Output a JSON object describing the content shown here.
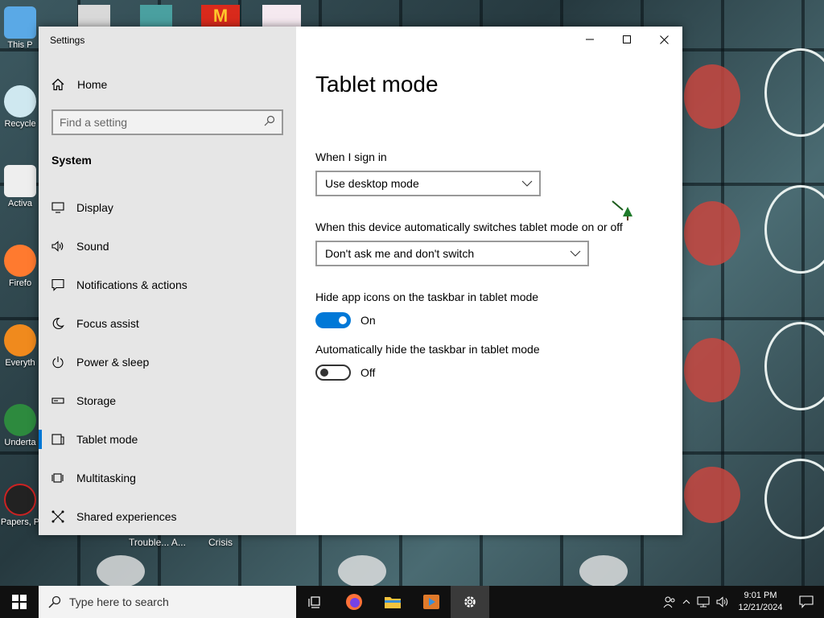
{
  "window": {
    "title": "Settings"
  },
  "sidebar": {
    "home_label": "Home",
    "search_placeholder": "Find a setting",
    "section_title": "System",
    "items": [
      {
        "label": "Display",
        "icon": "monitor-icon"
      },
      {
        "label": "Sound",
        "icon": "speaker-icon"
      },
      {
        "label": "Notifications & actions",
        "icon": "notifications-icon"
      },
      {
        "label": "Focus assist",
        "icon": "moon-icon"
      },
      {
        "label": "Power & sleep",
        "icon": "power-icon"
      },
      {
        "label": "Storage",
        "icon": "storage-icon"
      },
      {
        "label": "Tablet mode",
        "icon": "tablet-icon",
        "active": true
      },
      {
        "label": "Multitasking",
        "icon": "multitasking-icon"
      },
      {
        "label": "Shared experiences",
        "icon": "shared-experiences-icon"
      }
    ]
  },
  "main": {
    "title": "Tablet mode",
    "sign_in_label": "When I sign in",
    "sign_in_value": "Use desktop mode",
    "switch_label": "When this device automatically switches tablet mode on or off",
    "switch_value": "Don't ask me and don't switch",
    "hide_icons_label": "Hide app icons on the taskbar in tablet mode",
    "hide_icons_state": "On",
    "hide_taskbar_label": "Automatically hide the taskbar in tablet mode",
    "hide_taskbar_state": "Off"
  },
  "desktop": {
    "icons": [
      "This P",
      "Recycle",
      "Activa",
      "Firefo",
      "Everyth",
      "Underta",
      "Papers, P"
    ],
    "extra_labels": [
      "Trouble... A...",
      "Crisis"
    ]
  },
  "taskbar": {
    "search_placeholder": "Type here to search",
    "time": "9:01 PM",
    "date": "12/21/2024"
  },
  "colors": {
    "accent": "#0078d7",
    "sidebar_bg": "#e6e6e6",
    "taskbar_bg": "#101010"
  }
}
